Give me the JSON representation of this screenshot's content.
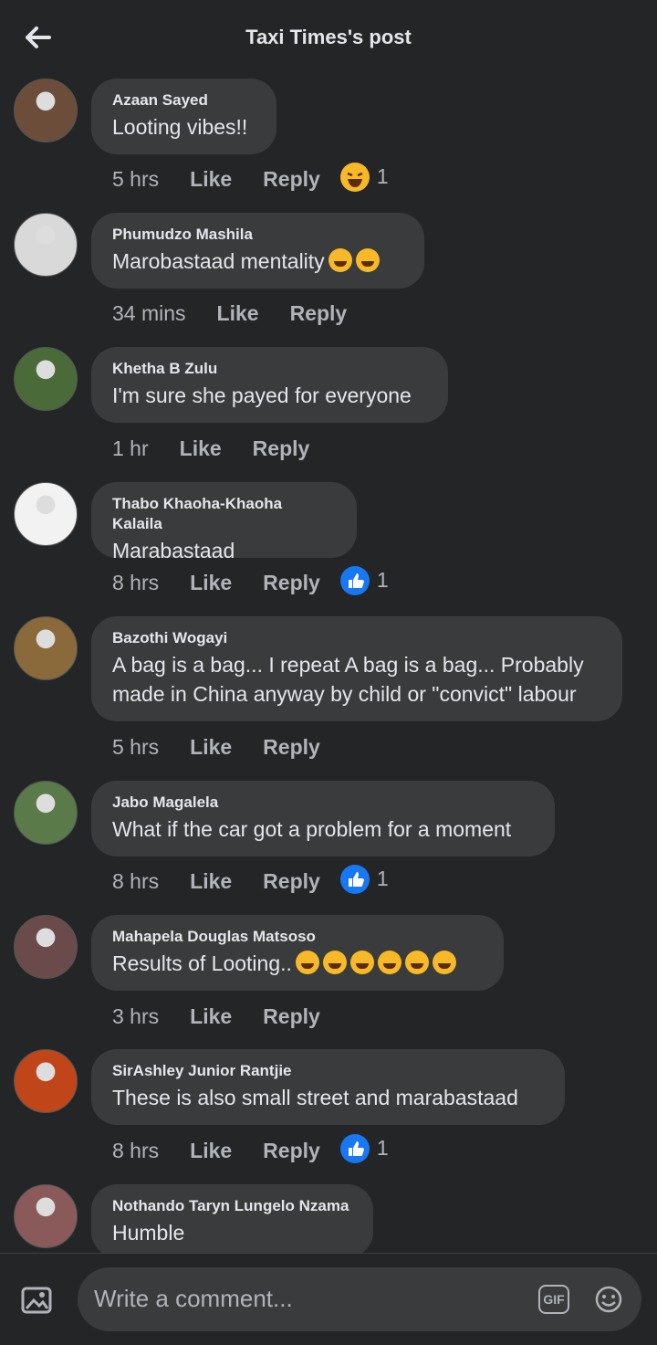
{
  "header": {
    "title": "Taxi Times's post",
    "back_icon": "back-arrow-icon"
  },
  "actions": {
    "like": "Like",
    "reply": "Reply"
  },
  "comments": [
    {
      "name": "Azaan Sayed",
      "text": "Looting vibes!!",
      "time": "5 hrs",
      "reaction": {
        "type": "laugh",
        "count": "1"
      },
      "emojis": 0
    },
    {
      "name": "Phumudzo Mashila",
      "text": "Marobastaad mentality",
      "time": "34 mins",
      "reaction": null,
      "emojis": 2
    },
    {
      "name": "Khetha B Zulu",
      "text": "I'm sure she payed for everyone",
      "time": "1 hr",
      "reaction": null,
      "emojis": 0
    },
    {
      "name": "Thabo Khaoha-Khaoha Kalaila",
      "text": "Marabastaad",
      "time": "8 hrs",
      "reaction": {
        "type": "like",
        "count": "1"
      },
      "emojis": 0
    },
    {
      "name": "Bazothi Wogayi",
      "text": "A bag is a bag... I repeat A bag is a bag... Probably\nmade in China anyway by child or \"convict\" labour",
      "time": "5 hrs",
      "reaction": null,
      "emojis": 0
    },
    {
      "name": "Jabo Magalela",
      "text": "What if the car got a problem for a moment",
      "time": "8 hrs",
      "reaction": {
        "type": "like",
        "count": "1"
      },
      "emojis": 0
    },
    {
      "name": "Mahapela Douglas Matsoso",
      "text": "Results of Looting..",
      "time": "3 hrs",
      "reaction": null,
      "emojis": 6
    },
    {
      "name": "SirAshley Junior Rantjie",
      "text": "These is also small street and marabastaad",
      "time": "8 hrs",
      "reaction": {
        "type": "like",
        "count": "1"
      },
      "emojis": 0
    },
    {
      "name": "Nothando Taryn Lungelo Nzama",
      "text": "Humble",
      "time": "",
      "reaction": null,
      "emojis": 0
    }
  ],
  "composer": {
    "placeholder": "Write a comment...",
    "gif_label": "GIF"
  },
  "colors": {
    "background": "#242526",
    "bubble": "#3a3b3c",
    "like_blue": "#1877f2",
    "emoji_yellow": "#f7b928"
  }
}
